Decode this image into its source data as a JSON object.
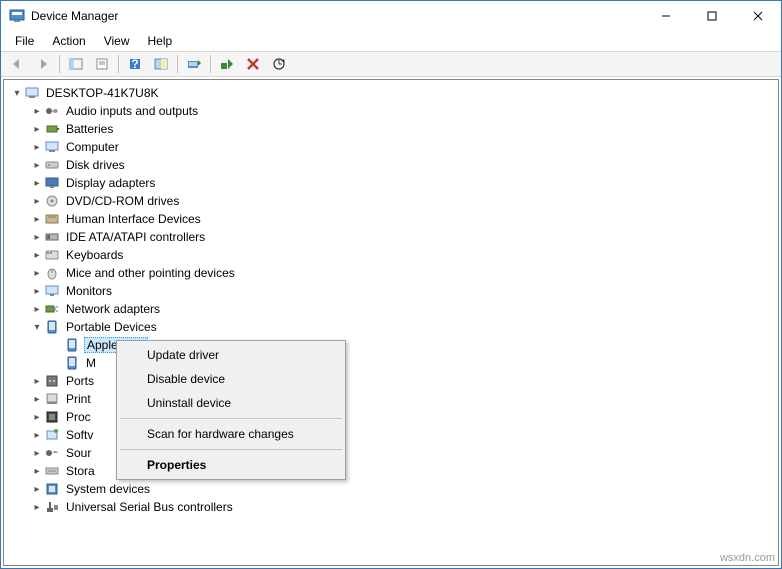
{
  "window": {
    "title": "Device Manager"
  },
  "menubar": [
    "File",
    "Action",
    "View",
    "Help"
  ],
  "tree": {
    "root": "DESKTOP-41K7U8K",
    "categories": [
      {
        "label": "Audio inputs and outputs",
        "expanded": false
      },
      {
        "label": "Batteries",
        "expanded": false
      },
      {
        "label": "Computer",
        "expanded": false
      },
      {
        "label": "Disk drives",
        "expanded": false
      },
      {
        "label": "Display adapters",
        "expanded": false
      },
      {
        "label": "DVD/CD-ROM drives",
        "expanded": false
      },
      {
        "label": "Human Interface Devices",
        "expanded": false
      },
      {
        "label": "IDE ATA/ATAPI controllers",
        "expanded": false
      },
      {
        "label": "Keyboards",
        "expanded": false
      },
      {
        "label": "Mice and other pointing devices",
        "expanded": false
      },
      {
        "label": "Monitors",
        "expanded": false
      },
      {
        "label": "Network adapters",
        "expanded": false
      },
      {
        "label": "Portable Devices",
        "expanded": true,
        "children": [
          {
            "label": "Apple iPad",
            "selected": true
          },
          {
            "label": "M"
          }
        ]
      },
      {
        "label": "Ports",
        "expanded": false
      },
      {
        "label": "Print",
        "expanded": false
      },
      {
        "label": "Proc",
        "expanded": false
      },
      {
        "label": "Softv",
        "expanded": false
      },
      {
        "label": "Sour",
        "expanded": false
      },
      {
        "label": "Stora",
        "expanded": false
      },
      {
        "label": "System devices",
        "expanded": false
      },
      {
        "label": "Universal Serial Bus controllers",
        "expanded": false
      }
    ]
  },
  "context_menu": {
    "update": "Update driver",
    "disable": "Disable device",
    "uninstall": "Uninstall device",
    "scan": "Scan for hardware changes",
    "properties": "Properties"
  },
  "watermark": "wsxdn.com"
}
